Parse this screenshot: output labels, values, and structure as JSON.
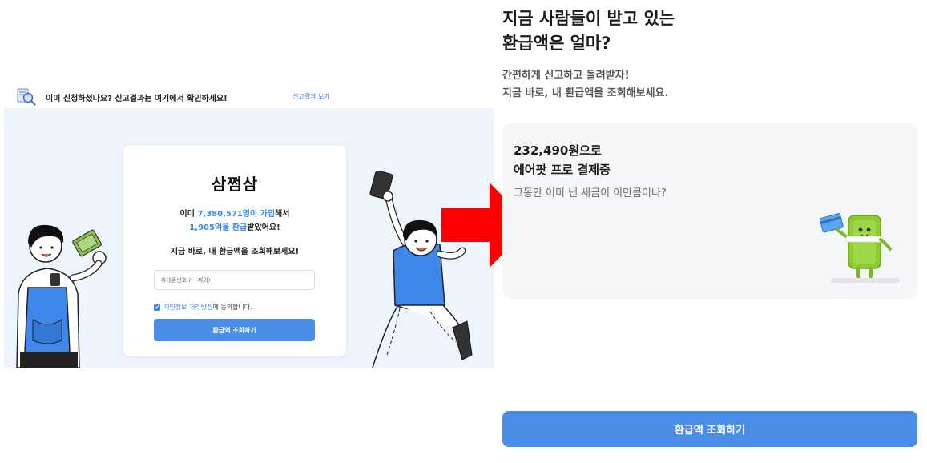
{
  "left_screenshot": {
    "notice": {
      "text": "이미 신청하셨나요? 신고결과는 여기에서 확인하세요!",
      "link": "신고결과 보기",
      "icon": "magnifier-document-icon"
    },
    "card": {
      "brand": "삼쩜삼",
      "stats_line1_prefix": "이미 ",
      "stats_line1_highlight": "7,380,571명이 가입",
      "stats_line1_suffix": "해서",
      "stats_line2_highlight": "1,905억을 환급",
      "stats_line2_suffix": "받았어요!",
      "subtitle": "지금 바로, 내 환급액을 조회해보세요!",
      "phone_placeholder": "휴대폰번호 ('-' 제외)",
      "consent_link": "개인정보 처리방침",
      "consent_text": "에 동의합니다.",
      "consent_checked": true,
      "button": "환급액 조회하기"
    }
  },
  "arrow": {
    "color": "#ff0000",
    "icon": "right-arrow-icon"
  },
  "right_panel": {
    "title_line1": "지금 사람들이 받고 있는",
    "title_line2": "환급액은 얼마?",
    "sub_line1": "간편하게 신고하고 돌려받자!",
    "sub_line2": "지금 바로, 내 환급액을 조회해보세요.",
    "card": {
      "amount_line1": "232,490원으로",
      "amount_line2": "에어팟 프로 결제중",
      "question": "그동안 이미 낸 세금이 이만큼이나?",
      "mascot_icon": "money-mascot-with-card-icon"
    },
    "button": "환급액 조회하기"
  },
  "colors": {
    "accent": "#4a8de6",
    "highlight": "#3f87e8",
    "arrow": "#ff0000",
    "page_bg": "#ffffff",
    "shot_bg": "#eef4fb",
    "card_bg": "#f5f6f8"
  }
}
